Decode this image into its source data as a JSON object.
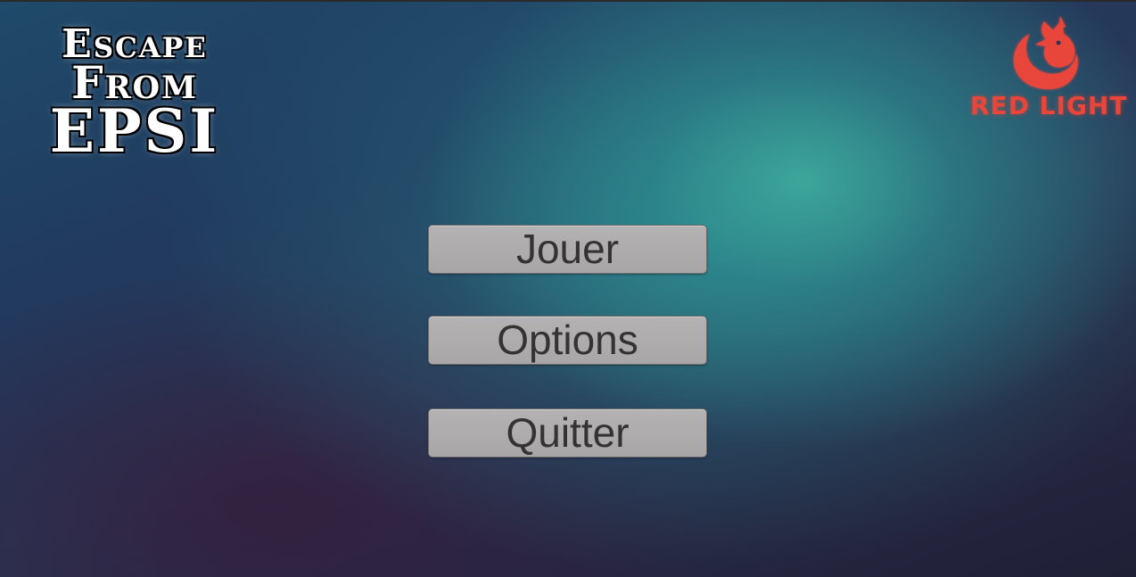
{
  "game": {
    "title_line1": "Escape",
    "title_line2": "From",
    "title_line3": "EPSI"
  },
  "studio": {
    "name": "RED LIGHT",
    "icon": "fox-icon",
    "color": "#e8453b"
  },
  "menu": {
    "play_label": "Jouer",
    "options_label": "Options",
    "quit_label": "Quitter"
  },
  "colors": {
    "button_background": "#b0aeaf",
    "button_text": "#343233",
    "background_accent": "#40b2a0"
  }
}
